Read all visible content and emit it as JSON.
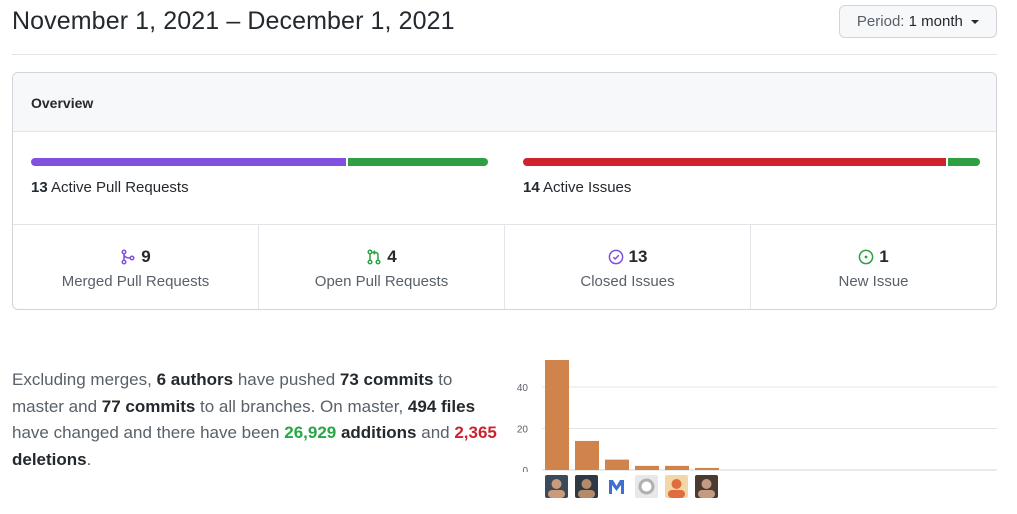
{
  "header": {
    "title": "November 1, 2021 – December 1, 2021",
    "period_prefix": "Period:",
    "period_value": "1 month"
  },
  "overview": {
    "title": "Overview",
    "pull_requests": {
      "count": "13",
      "label": "Active Pull Requests",
      "merged": 9,
      "open": 4,
      "colors": {
        "merged": "#8250df",
        "open": "#2ea043"
      }
    },
    "issues": {
      "count": "14",
      "label": "Active Issues",
      "closed": 13,
      "new": 1,
      "colors": {
        "closed": "#cf222e",
        "new": "#2ea043"
      }
    },
    "stats": [
      {
        "count": "9",
        "label": "Merged Pull Requests",
        "icon": "merge-icon",
        "color": "#8250df"
      },
      {
        "count": "4",
        "label": "Open Pull Requests",
        "icon": "pull-request-icon",
        "color": "#2ea043"
      },
      {
        "count": "13",
        "label": "Closed Issues",
        "icon": "issue-closed-icon",
        "color": "#8250df"
      },
      {
        "count": "1",
        "label": "New Issue",
        "icon": "issue-opened-icon",
        "color": "#2ea043"
      }
    ]
  },
  "summary": {
    "t1": "Excluding merges, ",
    "authors": "6 authors",
    "t2": " have pushed ",
    "commits_master": "73 commits",
    "t3": " to master and ",
    "commits_all": "77 commits",
    "t4": " to all branches. On master, ",
    "files": "494 files",
    "t5": " have changed and there have been ",
    "additions_num": "26,929",
    "additions_word": " additions",
    "t6": " and ",
    "deletions_num": "2,365",
    "deletions_word": " deletions",
    "t7": "."
  },
  "chart_data": {
    "type": "bar",
    "categories": [
      "author-1",
      "author-2",
      "author-3",
      "author-4",
      "author-5",
      "author-6"
    ],
    "values": [
      53,
      14,
      5,
      2,
      2,
      1
    ],
    "ylim": [
      0,
      53
    ],
    "yticks": [
      0,
      20,
      40
    ],
    "bar_color": "#d0834a",
    "grid": true
  }
}
